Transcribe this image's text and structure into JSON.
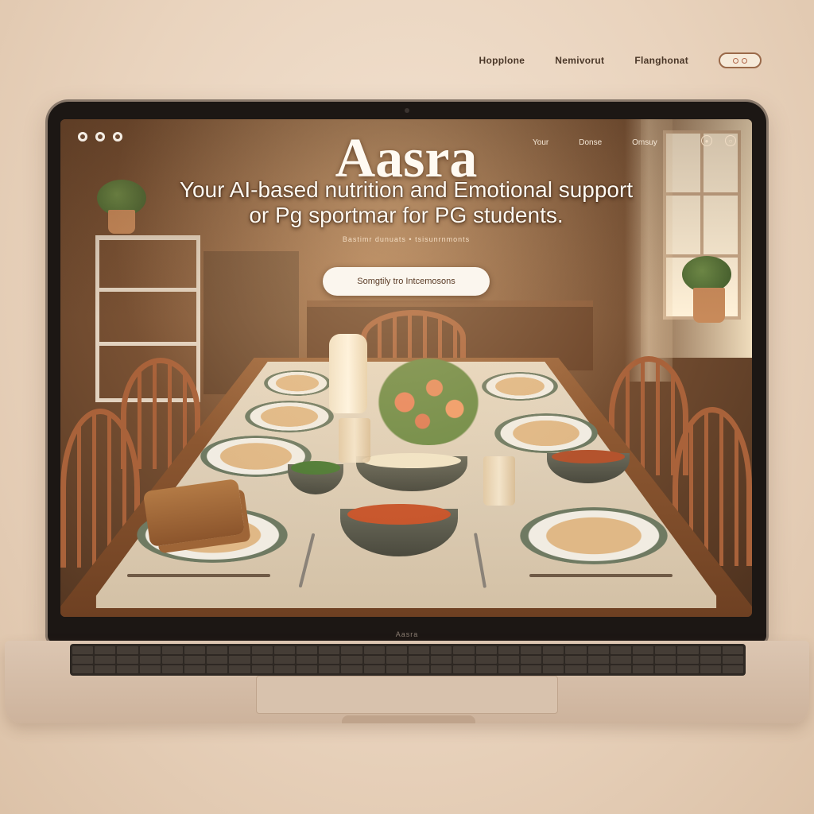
{
  "outer_nav": {
    "links": [
      "Hopplone",
      "Nemivorut",
      "Flanghonat"
    ],
    "toggle_icon": "toggle-switch-icon"
  },
  "laptop": {
    "brand_label": "Aasra"
  },
  "site": {
    "header": {
      "links": [
        "Your",
        "Donse",
        "Omsuy"
      ],
      "icons": [
        "user-icon",
        "settings-icon"
      ]
    },
    "hero": {
      "title": "Aasra",
      "tagline_line1": "Your AI-based nutrition and Emotional support",
      "tagline_line2": "or Pg sportmar for PG students.",
      "subtext": "Bastimr dunuats • tsisunrnmonts",
      "cta_label": "Somgtily tro Intcemosons"
    }
  },
  "colors": {
    "background": "#ecd9c6",
    "text_dark": "#4a3728",
    "accent": "#b0674a",
    "hero_text": "#fffaf2"
  }
}
